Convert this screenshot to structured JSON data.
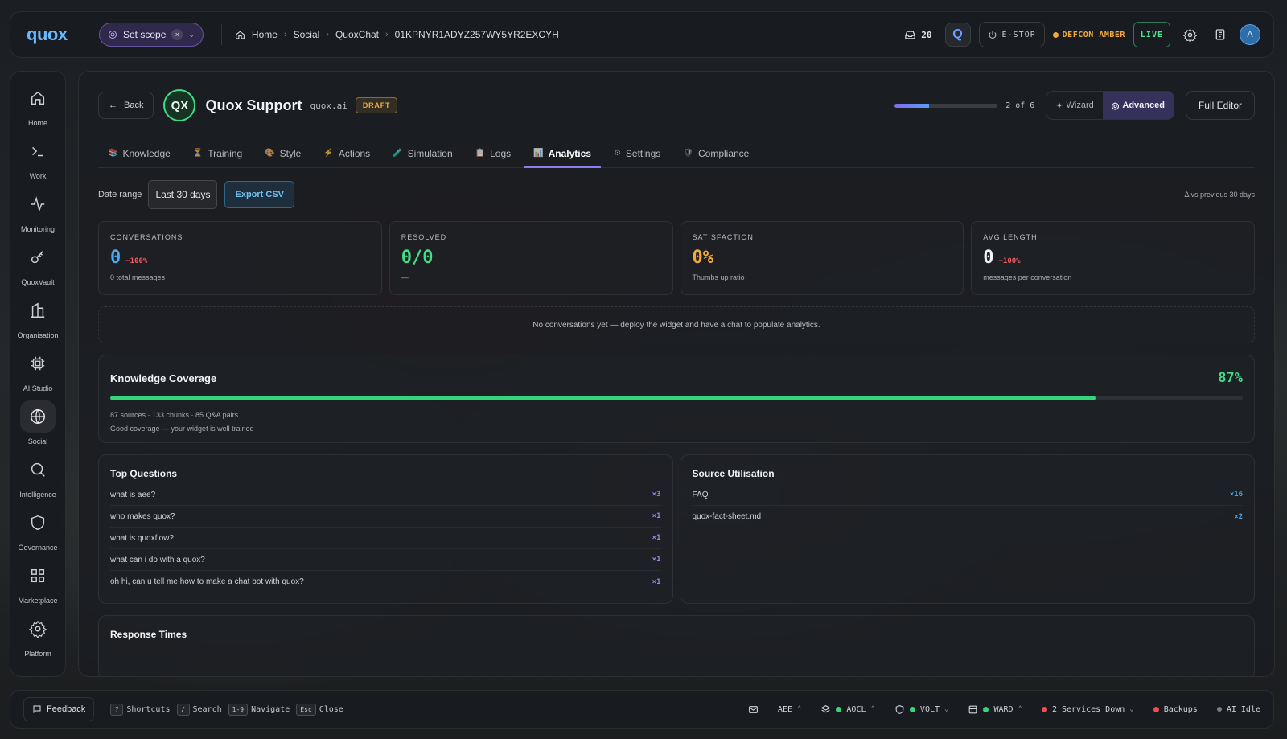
{
  "topbar": {
    "logo": "quox",
    "scope_label": "Set scope",
    "scope_clear": "×",
    "breadcrumbs": [
      "Home",
      "Social",
      "QuoxChat",
      "01KPNYR1ADYZ257WY5YR2EXCYH"
    ],
    "inbox_count": "20",
    "q_button": "Q",
    "estop_label": "E-STOP",
    "defcon_label": "DEFCON AMBER",
    "live_label": "LIVE",
    "avatar_initial": "A"
  },
  "sidebar": {
    "items": [
      {
        "label": "Home",
        "icon": "home-icon"
      },
      {
        "label": "Work",
        "icon": "terminal-icon"
      },
      {
        "label": "Monitoring",
        "icon": "activity-icon"
      },
      {
        "label": "QuoxVault",
        "icon": "key-icon"
      },
      {
        "label": "Organisation",
        "icon": "building-icon"
      },
      {
        "label": "AI Studio",
        "icon": "chip-icon"
      },
      {
        "label": "Social",
        "icon": "globe-icon"
      },
      {
        "label": "Intelligence",
        "icon": "search-icon"
      },
      {
        "label": "Governance",
        "icon": "shield-icon"
      },
      {
        "label": "Marketplace",
        "icon": "grid-icon"
      },
      {
        "label": "Platform",
        "icon": "gear-icon"
      }
    ],
    "active": "Social"
  },
  "header": {
    "back_label": "Back",
    "badge": "QX",
    "title": "Quox Support",
    "domain": "quox.ai",
    "status": "DRAFT",
    "step_text": "2 of 6",
    "step_progress": 0.333,
    "mode_wizard": "Wizard",
    "mode_advanced": "Advanced",
    "full_editor": "Full Editor"
  },
  "tabs": [
    {
      "label": "Knowledge",
      "icon": "📚"
    },
    {
      "label": "Training",
      "icon": "⏳"
    },
    {
      "label": "Style",
      "icon": "🎨"
    },
    {
      "label": "Actions",
      "icon": "⚡"
    },
    {
      "label": "Simulation",
      "icon": "🧪"
    },
    {
      "label": "Logs",
      "icon": "📋"
    },
    {
      "label": "Analytics",
      "icon": "📊"
    },
    {
      "label": "Settings",
      "icon": "⚙"
    },
    {
      "label": "Compliance",
      "icon": "🛡"
    }
  ],
  "active_tab": "Analytics",
  "analytics": {
    "date_range_label": "Date range",
    "date_range_value": "Last 30 days",
    "export_label": "Export CSV",
    "comparison_note": "Δ vs previous 30 days",
    "kpis": [
      {
        "label": "CONVERSATIONS",
        "value": "0",
        "delta": "−100%",
        "sub": "0 total messages",
        "color": "#4aa8f0"
      },
      {
        "label": "RESOLVED",
        "value": "0/0",
        "delta": "",
        "sub": "—",
        "color": "#42dd86"
      },
      {
        "label": "SATISFACTION",
        "value": "0%",
        "delta": "",
        "sub": "Thumbs up ratio",
        "color": "#f2a93b"
      },
      {
        "label": "AVG LENGTH",
        "value": "0",
        "delta": "−100%",
        "sub": "messages per conversation",
        "color": "#f1f3f5"
      }
    ],
    "empty_message": "No conversations yet — deploy the widget and have a chat to populate analytics.",
    "coverage": {
      "title": "Knowledge Coverage",
      "percent_label": "87%",
      "percent": 87,
      "meta": "87 sources · 133 chunks · 85 Q&A pairs",
      "note": "Good coverage — your widget is well trained"
    },
    "top_questions": {
      "title": "Top Questions",
      "items": [
        {
          "q": "what is aee?",
          "count": "×3"
        },
        {
          "q": "who makes quox?",
          "count": "×1"
        },
        {
          "q": "what is quoxflow?",
          "count": "×1"
        },
        {
          "q": "what can i do with a quox?",
          "count": "×1"
        },
        {
          "q": "oh hi, can u tell me how to make a chat bot with quox?",
          "count": "×1"
        }
      ]
    },
    "source_utilisation": {
      "title": "Source Utilisation",
      "items": [
        {
          "source": "FAQ",
          "count": "×16"
        },
        {
          "source": "quox-fact-sheet.md",
          "count": "×2"
        }
      ]
    },
    "response_times_title": "Response Times"
  },
  "bottombar": {
    "feedback_label": "Feedback",
    "hints": [
      {
        "key": "?",
        "text": "Shortcuts"
      },
      {
        "key": "/",
        "text": "Search"
      },
      {
        "key": "1-9",
        "text": "Navigate"
      },
      {
        "key": "Esc",
        "text": "Close"
      }
    ],
    "status": {
      "aee": "AEE",
      "aocl": "AOCL",
      "volt": "VOLT",
      "ward": "WARD",
      "services": "2 Services Down",
      "backups": "Backups",
      "ai": "AI Idle"
    }
  },
  "colors": {
    "accent": "#8c7cf0",
    "success": "#42dd86",
    "warning": "#f2a93b",
    "danger": "#ef5b5b",
    "info": "#4aa8f0"
  }
}
